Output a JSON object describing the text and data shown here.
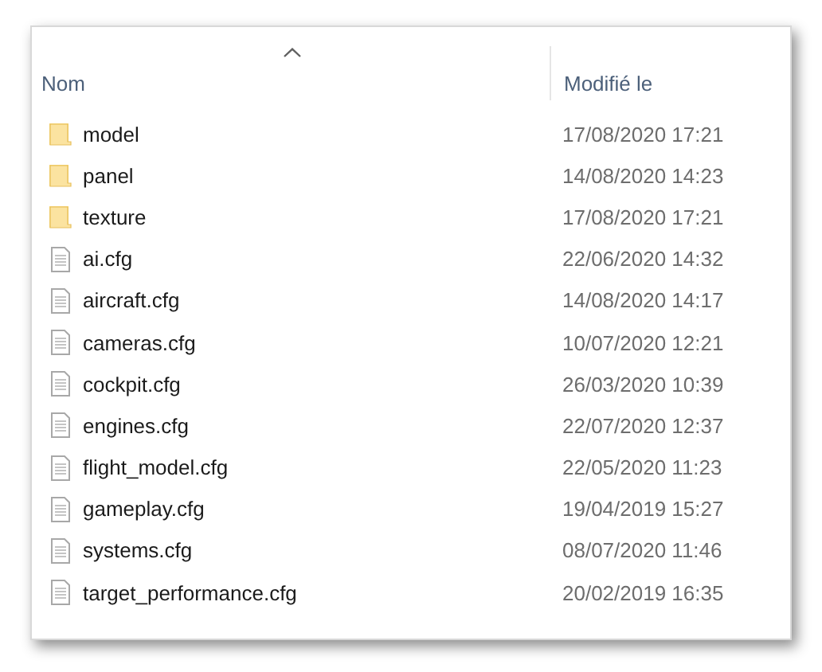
{
  "columns": [
    {
      "label": "Nom",
      "sorted": true
    },
    {
      "label": "Modifié le",
      "sorted": false
    }
  ],
  "rows": [
    {
      "kind": "folder",
      "name": "model",
      "modified": "17/08/2020 17:21"
    },
    {
      "kind": "folder",
      "name": "panel",
      "modified": "14/08/2020 14:23"
    },
    {
      "kind": "folder",
      "name": "texture",
      "modified": "17/08/2020 17:21"
    },
    {
      "kind": "file",
      "name": "ai.cfg",
      "modified": "22/06/2020 14:32"
    },
    {
      "kind": "file",
      "name": "aircraft.cfg",
      "modified": "14/08/2020 14:17"
    },
    {
      "kind": "file",
      "name": "cameras.cfg",
      "modified": "10/07/2020 12:21"
    },
    {
      "kind": "file",
      "name": "cockpit.cfg",
      "modified": "26/03/2020 10:39"
    },
    {
      "kind": "file",
      "name": "engines.cfg",
      "modified": "22/07/2020 12:37"
    },
    {
      "kind": "file",
      "name": "flight_model.cfg",
      "modified": "22/05/2020 11:23"
    },
    {
      "kind": "file",
      "name": "gameplay.cfg",
      "modified": "19/04/2019 15:27"
    },
    {
      "kind": "file",
      "name": "systems.cfg",
      "modified": "08/07/2020 11:46"
    },
    {
      "kind": "file",
      "name": "target_performance.cfg",
      "modified": "20/02/2019 16:35"
    }
  ]
}
